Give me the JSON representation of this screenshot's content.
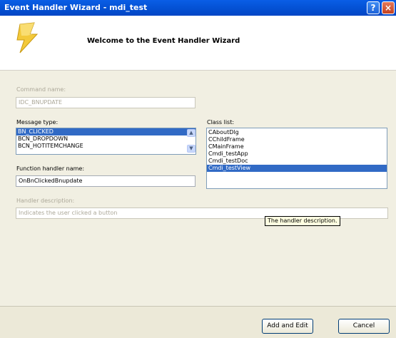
{
  "window": {
    "title": "Event Handler Wizard - mdi_test"
  },
  "titlebar": {
    "help_label": "?",
    "close_label": "×"
  },
  "header": {
    "title": "Welcome to the Event Handler Wizard"
  },
  "command_name": {
    "label": "Command name:",
    "value": "IDC_BNUPDATE"
  },
  "message_type": {
    "label": "Message type:",
    "items": [
      "BN_CLICKED",
      "BCN_DROPDOWN",
      "BCN_HOTITEMCHANGE"
    ],
    "selected_index": 0,
    "scroll_up": "▲",
    "scroll_down": "▼"
  },
  "class_list": {
    "label": "Class list:",
    "items": [
      "CAboutDlg",
      "CChildFrame",
      "CMainFrame",
      "Cmdi_testApp",
      "Cmdi_testDoc",
      "Cmdi_testView"
    ],
    "selected_index": 5
  },
  "function_handler": {
    "label": "Function handler name:",
    "value": "OnBnClickedBnupdate"
  },
  "handler_description": {
    "label": "Handler description:",
    "value": "Indicates the user clicked a button"
  },
  "tooltip": {
    "text": "The handler description."
  },
  "buttons": {
    "add_edit": "Add and Edit",
    "cancel": "Cancel"
  },
  "colors": {
    "titlebar": "#0554d8",
    "selection": "#316ac5",
    "dialog_bg": "#f1efe2"
  }
}
